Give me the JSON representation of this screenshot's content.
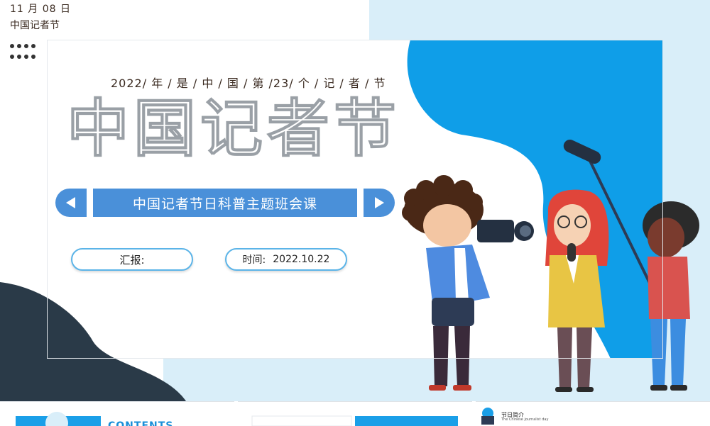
{
  "header": {
    "date": "11 月 08 日",
    "subtitle": "中国记者节"
  },
  "slide": {
    "year_line": "2022/ 年 / 是 / 中 / 国 / 第 /23/ 个 / 记 / 者 / 节",
    "big_title": "中国记者节",
    "banner": "中国记者节日科普主题班会课",
    "reporter_label": "汇报:",
    "time_label": "时间:",
    "time_value": "2022.10.22"
  },
  "thumbnails": [
    {
      "label": "CONTENTS"
    },
    {
      "label": ""
    },
    {
      "title": "节日简介",
      "subtitle": "The Chinese journalist day"
    }
  ],
  "icons": [
    "dots-icon",
    "arrow-left-icon",
    "arrow-right-icon"
  ],
  "colors": {
    "accent": "#4a90d9",
    "blue_blob": "#0f9ee8",
    "light_blue": "#d9eef9",
    "dark_navy": "#2a3a48"
  }
}
